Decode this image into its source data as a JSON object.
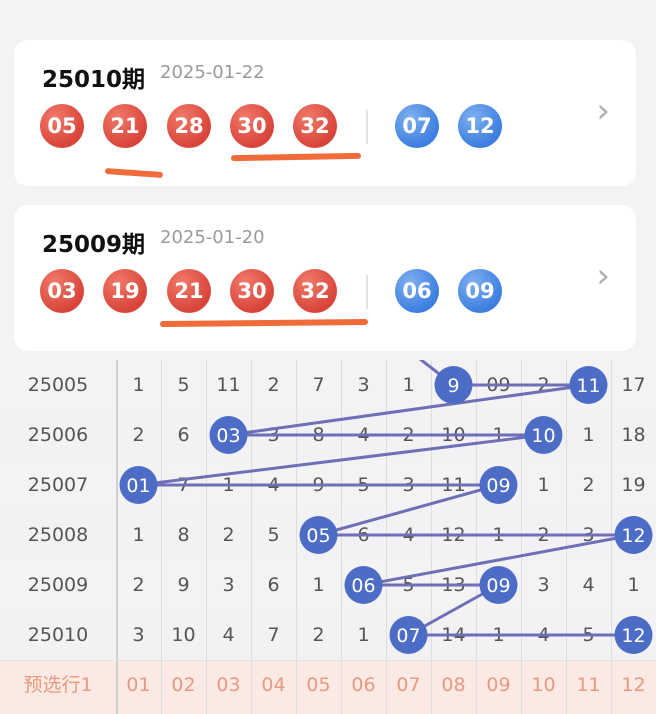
{
  "colors": {
    "red_ball": "#d9443a",
    "blue_ball": "#3d7ee0",
    "highlight_line": "#ef6b3a",
    "trend_line": "#6f6fb8",
    "trend_dot": "#4d6cc6"
  },
  "draws": [
    {
      "issue": "25010期",
      "date": "2025-01-22",
      "red": [
        "05",
        "21",
        "28",
        "30",
        "32"
      ],
      "blue": [
        "07",
        "12"
      ]
    },
    {
      "issue": "25009期",
      "date": "2025-01-20",
      "red": [
        "03",
        "19",
        "21",
        "30",
        "32"
      ],
      "blue": [
        "06",
        "09"
      ]
    }
  ],
  "chevron_icon": "chevron-right-icon",
  "trend_table": {
    "rows": [
      {
        "issue": "25005",
        "cells": [
          "1",
          "5",
          "11",
          "2",
          "7",
          "3",
          "1",
          "9",
          "09",
          "2",
          "11",
          "17"
        ],
        "hits": [
          9,
          11
        ]
      },
      {
        "issue": "25006",
        "cells": [
          "2",
          "6",
          "03",
          "3",
          "8",
          "4",
          "2",
          "10",
          "1",
          "10",
          "1",
          "18"
        ],
        "hits": [
          3,
          10
        ]
      },
      {
        "issue": "25007",
        "cells": [
          "01",
          "7",
          "1",
          "4",
          "9",
          "5",
          "3",
          "11",
          "09",
          "1",
          "2",
          "19"
        ],
        "hits": [
          1,
          9
        ]
      },
      {
        "issue": "25008",
        "cells": [
          "1",
          "8",
          "2",
          "5",
          "05",
          "6",
          "4",
          "12",
          "1",
          "2",
          "3",
          "12"
        ],
        "hits": [
          5,
          12
        ]
      },
      {
        "issue": "25009",
        "cells": [
          "2",
          "9",
          "3",
          "6",
          "1",
          "06",
          "5",
          "13",
          "09",
          "3",
          "4",
          "1"
        ],
        "hits": [
          6,
          9
        ]
      },
      {
        "issue": "25010",
        "cells": [
          "3",
          "10",
          "4",
          "7",
          "2",
          "1",
          "07",
          "14",
          "1",
          "4",
          "5",
          "12"
        ],
        "hits": [
          7,
          12
        ]
      }
    ],
    "select_row": {
      "label": "预选行1",
      "cells": [
        "01",
        "02",
        "03",
        "04",
        "05",
        "06",
        "07",
        "08",
        "09",
        "10",
        "11",
        "12"
      ]
    },
    "trend_path": [
      {
        "row": 0,
        "col": 8
      },
      {
        "row": 0,
        "col": 11
      },
      {
        "row": 1,
        "col": 3
      },
      {
        "row": 1,
        "col": 10
      },
      {
        "row": 2,
        "col": 1
      },
      {
        "row": 2,
        "col": 9
      },
      {
        "row": 3,
        "col": 5
      },
      {
        "row": 3,
        "col": 12
      },
      {
        "row": 4,
        "col": 6
      },
      {
        "row": 4,
        "col": 9
      },
      {
        "row": 5,
        "col": 7
      },
      {
        "row": 5,
        "col": 12
      }
    ]
  }
}
